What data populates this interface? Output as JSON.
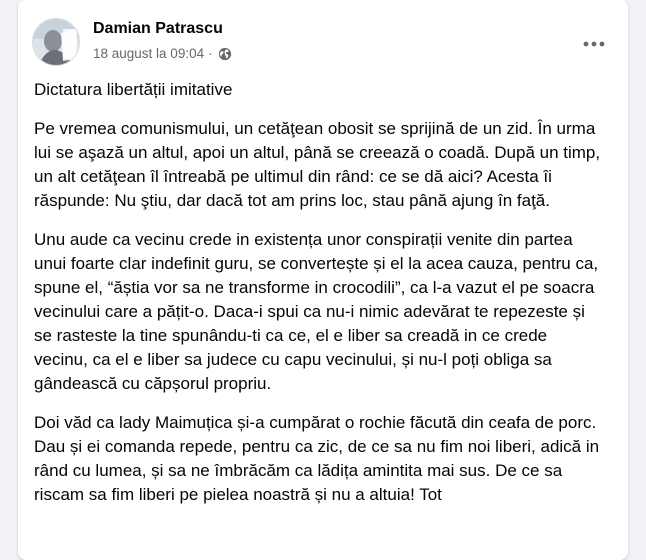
{
  "post": {
    "author": "Damian Patrascu",
    "date": "18 august la 09:04",
    "separator": "·",
    "privacy_icon": "globe-icon",
    "more_icon": "more-options-icon",
    "title": "Dictatura libertății imitative",
    "paragraphs": [
      "Pe vremea comunismului, un cetăţean obosit se sprijină de un zid. În urma lui se aşază un altul, apoi un altul, până se creează o coadă. După un timp, un alt cetăţean îl întreabă pe ultimul din rând: ce se dă aici? Acesta îi răspunde: Nu ştiu, dar dacă tot am prins loc, stau până ajung în faţă.",
      "Unu aude ca vecinu crede in existența unor conspirații venite din partea unui foarte clar indefinit guru, se convertește și el la acea cauza, pentru ca, spune el, “ăștia vor sa ne transforme in crocodili”, ca l-a vazut el pe soacra vecinului care a pățit-o. Daca-i spui ca nu-i nimic adevărat te repezeste și se rasteste la tine spunându-ti ca ce, el e liber sa creadă in ce crede vecinu, ca el e liber sa judece cu capu vecinului, și nu-l poți obliga sa gândească cu căpșorul propriu.",
      "Doi văd ca lady Maimuțica și-a cumpărat o rochie făcută din ceafa de porc. Dau și ei comanda repede, pentru ca zic, de ce sa nu fim noi liberi, adică in rând cu lumea, și sa ne îmbrăcăm ca lădița amintita mai sus. De ce sa riscam sa fim liberi pe pielea noastră și nu a altuia! Tot"
    ]
  },
  "colors": {
    "page_bg": "#f0f2f5",
    "card_bg": "#ffffff",
    "text": "#050505",
    "secondary_text": "#65676b"
  }
}
